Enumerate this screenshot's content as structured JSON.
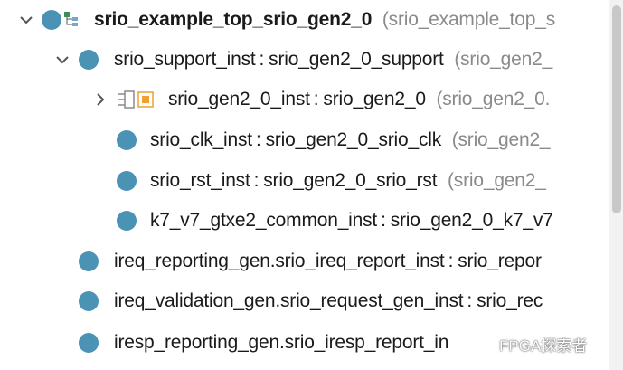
{
  "tree": {
    "rows": [
      {
        "name": "srio_example_top_srio_gen2_0",
        "sep": "",
        "module": "",
        "file": "(srio_example_top_s"
      },
      {
        "name": "srio_support_inst",
        "sep": ":",
        "module": "srio_gen2_0_support",
        "file": "(srio_gen2_"
      },
      {
        "name": "srio_gen2_0_inst",
        "sep": ":",
        "module": "srio_gen2_0",
        "file": "(srio_gen2_0."
      },
      {
        "name": "srio_clk_inst",
        "sep": ":",
        "module": "srio_gen2_0_srio_clk",
        "file": "(srio_gen2_"
      },
      {
        "name": "srio_rst_inst",
        "sep": ":",
        "module": "srio_gen2_0_srio_rst",
        "file": "(srio_gen2_"
      },
      {
        "name": "k7_v7_gtxe2_common_inst",
        "sep": ":",
        "module": "srio_gen2_0_k7_v7",
        "file": ""
      },
      {
        "name": "ireq_reporting_gen.srio_ireq_report_inst",
        "sep": ":",
        "module": "srio_repor",
        "file": ""
      },
      {
        "name": "ireq_validation_gen.srio_request_gen_inst",
        "sep": ":",
        "module": "srio_rec",
        "file": ""
      },
      {
        "name": "iresp_reporting_gen.srio_iresp_report_in",
        "sep": "",
        "module": "",
        "file": ""
      }
    ]
  },
  "watermark": {
    "text": "FPGA探索者"
  },
  "icons": {
    "expanded": "chevron-down-icon",
    "collapsed": "chevron-right-icon",
    "instance": "instance-dot-icon",
    "hierarchy": "hierarchy-icon",
    "ip_core": "ip-core-icon"
  },
  "colors": {
    "dot": "#4a93b5",
    "file_text": "#8a8a8a",
    "ip_orange": "#f0a030"
  }
}
